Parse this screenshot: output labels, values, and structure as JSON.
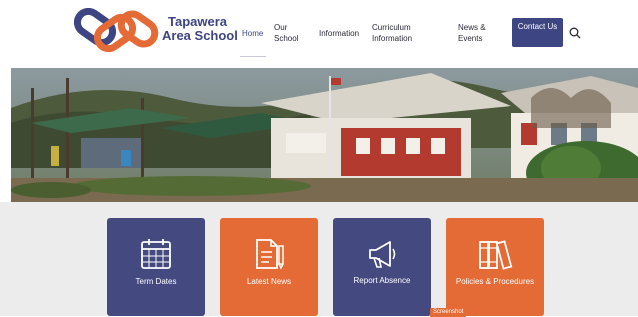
{
  "logo": {
    "line1": "Tapawera",
    "line2": "Area School",
    "colors": {
      "navy": "#3d4582",
      "orange": "#e46a36"
    }
  },
  "nav": {
    "home": "Home",
    "our_school": "Our School",
    "information": "Information",
    "curriculum": "Curriculum Information",
    "news": "News & Events",
    "contact": "Contact Us"
  },
  "hero": {
    "icon": "school-buildings-photo"
  },
  "tiles": [
    {
      "label": "Term Dates",
      "icon": "calendar-icon",
      "color": "#444a80"
    },
    {
      "label": "Latest News",
      "icon": "document-pencil-icon",
      "color": "#e46a36"
    },
    {
      "label": "Report Absence",
      "icon": "megaphone-icon",
      "color": "#444a80"
    },
    {
      "label": "Policies & Procedures",
      "icon": "books-icon",
      "color": "#e46a36"
    }
  ],
  "tooltip": "Screenshot"
}
